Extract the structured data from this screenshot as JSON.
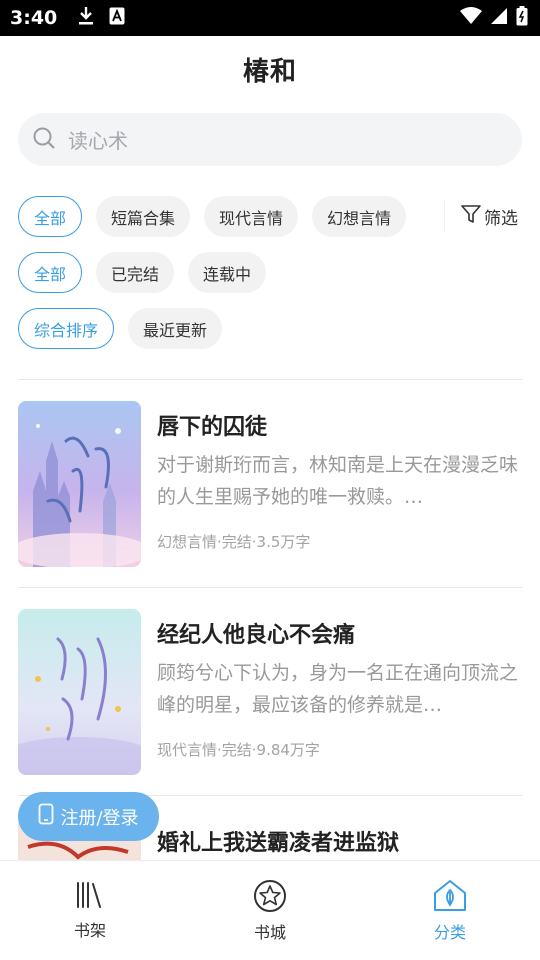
{
  "status_bar": {
    "time": "3:40"
  },
  "app_bar": {
    "title": "椿和"
  },
  "search": {
    "placeholder": "读心术"
  },
  "filters": {
    "category_chips": [
      "全部",
      "短篇合集",
      "现代言情",
      "幻想言情"
    ],
    "filter_label": "筛选",
    "status_chips": [
      "全部",
      "已完结",
      "连载中"
    ],
    "sort_chips": [
      "综合排序",
      "最近更新"
    ]
  },
  "books": [
    {
      "title": "唇下的囚徒",
      "description": "对于谢斯珩而言，林知南是上天在漫漫乏味的人生里赐予她的唯一救赎。…",
      "meta": "幻想言情·完结·3.5万字"
    },
    {
      "title": "经纪人他良心不会痛",
      "description": "顾筠兮心下认为，身为一名正在通向顶流之峰的明星，最应该备的修养就是…",
      "meta": "现代言情·完结·9.84万字"
    },
    {
      "title": "婚礼上我送霸凌者进监狱"
    }
  ],
  "login_button": {
    "label": "注册/登录"
  },
  "tab_bar": {
    "tabs": [
      {
        "label": "书架",
        "icon": "bookshelf-icon"
      },
      {
        "label": "书城",
        "icon": "bookstore-icon"
      },
      {
        "label": "分类",
        "icon": "category-icon"
      }
    ]
  },
  "colors": {
    "accent": "#3a9ee4",
    "login_button": "#6ab3ec"
  }
}
